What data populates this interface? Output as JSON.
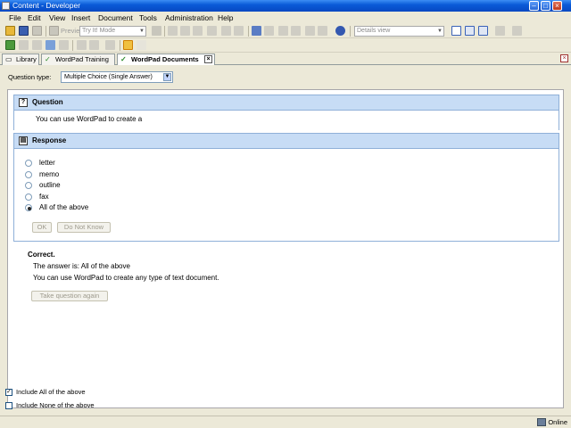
{
  "window": {
    "title": "Content - Developer"
  },
  "menu": {
    "items": [
      {
        "label": "File"
      },
      {
        "label": "Edit"
      },
      {
        "label": "View"
      },
      {
        "label": "Insert"
      },
      {
        "label": "Document"
      },
      {
        "label": "Tools"
      },
      {
        "label": "Administration"
      },
      {
        "label": "Help"
      }
    ]
  },
  "toolbar": {
    "preview_label": "Preview",
    "mode_value": "Try It! Mode",
    "view_value": "Details view"
  },
  "tabs": [
    {
      "label": "Library",
      "icon": "book-icon"
    },
    {
      "label": "WordPad Training",
      "icon": "check-icon"
    },
    {
      "label": "WordPad Documents",
      "icon": "question-icon",
      "active": true
    }
  ],
  "question_type": {
    "label": "Question type:",
    "value": "Multiple Choice (Single Answer)"
  },
  "question": {
    "header": "Question",
    "text": "You can use WordPad to create a"
  },
  "response": {
    "header": "Response",
    "options": [
      {
        "label": "letter",
        "checked": false
      },
      {
        "label": "memo",
        "checked": false
      },
      {
        "label": "outline",
        "checked": false
      },
      {
        "label": "fax",
        "checked": false
      },
      {
        "label": "All of the above",
        "checked": true
      }
    ],
    "ok_label": "OK",
    "dont_know_label": "Do Not Know"
  },
  "feedback": {
    "title": "Correct.",
    "answer": "The answer is: All of the above",
    "explanation": "You can use WordPad to create any type of text document.",
    "retake_label": "Take question again"
  },
  "settings": {
    "include_all": {
      "label": "Include All of the above",
      "checked": true
    },
    "include_none": {
      "label": "Include None of the above",
      "checked": false
    }
  },
  "status": {
    "text": "Online"
  },
  "colors": {
    "title_bar": "#0a5bd8",
    "section_header": "#c7dcf5",
    "active_tab": "#ffffff"
  }
}
